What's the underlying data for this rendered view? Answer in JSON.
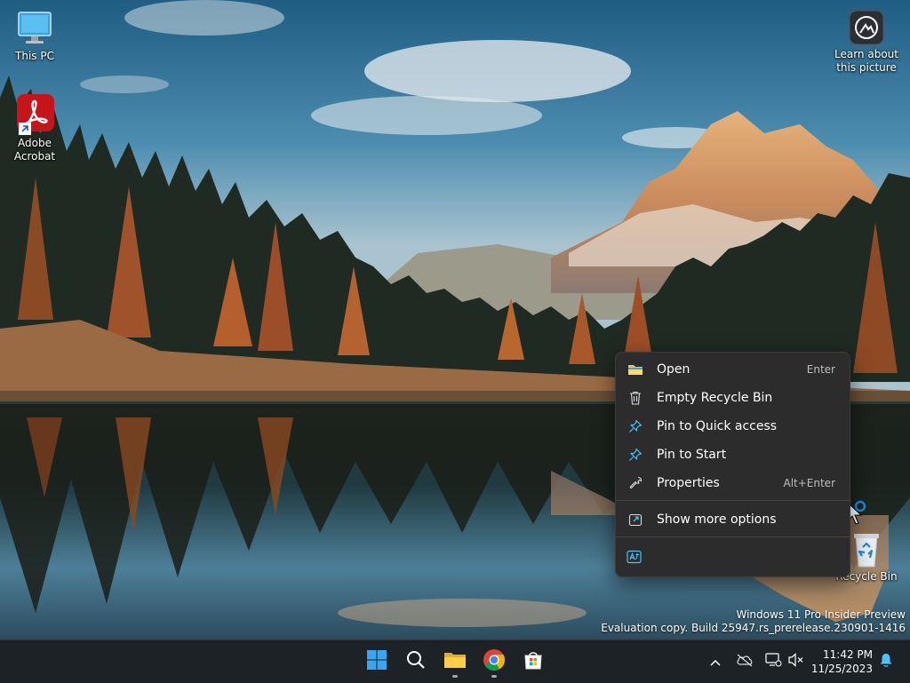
{
  "desktop": {
    "icons": [
      {
        "label": "This PC",
        "icon": "monitor-icon"
      },
      {
        "label": "Adobe\nAcrobat",
        "icon": "acrobat-icon"
      },
      {
        "label": "Learn about\nthis picture",
        "icon": "camera-info-icon"
      },
      {
        "label": "Recycle Bin",
        "icon": "recycle-bin-icon"
      }
    ],
    "watermark": {
      "line1": "Windows 11 Pro Insider Preview",
      "line2": "Evaluation copy. Build 25947.rs_prerelease.230901-1416"
    }
  },
  "context_menu": {
    "items": [
      {
        "label": "Open",
        "shortcut": "Enter",
        "icon": "folder-icon"
      },
      {
        "label": "Empty Recycle Bin",
        "shortcut": "",
        "icon": "trash-icon"
      },
      {
        "label": "Pin to Quick access",
        "shortcut": "",
        "icon": "pin-icon"
      },
      {
        "label": "Pin to Start",
        "shortcut": "",
        "icon": "pin-icon"
      },
      {
        "label": "Properties",
        "shortcut": "Alt+Enter",
        "icon": "wrench-icon"
      },
      {
        "label": "Show more options",
        "shortcut": "",
        "icon": "share-icon"
      }
    ],
    "bottom_action_icon": "translate-icon"
  },
  "taskbar": {
    "apps": [
      {
        "name": "Start",
        "icon": "windows-logo-icon"
      },
      {
        "name": "Search",
        "icon": "search-icon"
      },
      {
        "name": "File Explorer",
        "icon": "folder-icon"
      },
      {
        "name": "Google Chrome",
        "icon": "chrome-icon"
      },
      {
        "name": "Microsoft Store",
        "icon": "store-icon"
      }
    ],
    "clock": {
      "time": "11:42 PM",
      "date": "11/25/2023"
    }
  },
  "colors": {
    "menu_bg": "#2c2c2c",
    "taskbar_bg": "#1c2226",
    "accent": "#4cc2ff"
  }
}
